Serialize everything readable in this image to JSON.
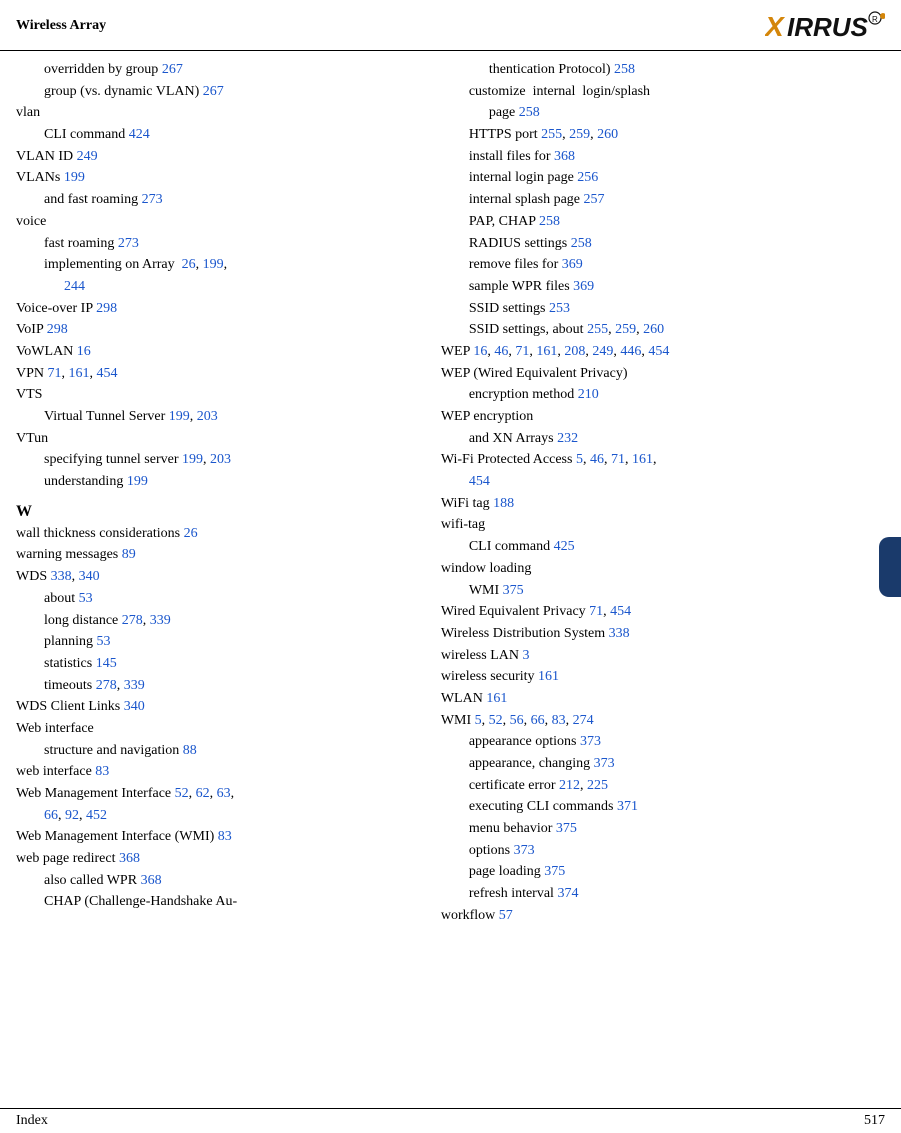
{
  "header": {
    "title": "Wireless Array",
    "logo": "XIRRUS"
  },
  "footer": {
    "left": "Index",
    "right": "517"
  },
  "left_column": [
    {
      "type": "sub-term",
      "text": "overridden by group ",
      "refs": [
        {
          "text": "267",
          "page": "267"
        }
      ]
    },
    {
      "type": "sub-term",
      "text": "group (vs. dynamic VLAN) ",
      "refs": [
        {
          "text": "267",
          "page": "267"
        }
      ]
    },
    {
      "type": "main-term",
      "text": "vlan"
    },
    {
      "type": "sub-term",
      "text": "CLI command ",
      "refs": [
        {
          "text": "424",
          "page": "424"
        }
      ]
    },
    {
      "type": "main-term",
      "text": "VLAN ID ",
      "refs": [
        {
          "text": "249",
          "page": "249"
        }
      ]
    },
    {
      "type": "main-term",
      "text": "VLANs ",
      "refs": [
        {
          "text": "199",
          "page": "199"
        }
      ]
    },
    {
      "type": "sub-term",
      "text": "and fast roaming ",
      "refs": [
        {
          "text": "273",
          "page": "273"
        }
      ]
    },
    {
      "type": "main-term",
      "text": "voice"
    },
    {
      "type": "sub-term",
      "text": "fast roaming ",
      "refs": [
        {
          "text": "273",
          "page": "273"
        }
      ]
    },
    {
      "type": "sub-term",
      "text": "implementing on Array ",
      "refs": [
        {
          "text": "26",
          "page": "26"
        },
        {
          "text": "199",
          "page": "199"
        },
        {
          "text": "244",
          "page": "244"
        }
      ]
    },
    {
      "type": "main-term",
      "text": "Voice-over IP ",
      "refs": [
        {
          "text": "298",
          "page": "298"
        }
      ]
    },
    {
      "type": "main-term",
      "text": "VoIP ",
      "refs": [
        {
          "text": "298",
          "page": "298"
        }
      ]
    },
    {
      "type": "main-term",
      "text": "VoWLAN ",
      "refs": [
        {
          "text": "16",
          "page": "16"
        }
      ]
    },
    {
      "type": "main-term",
      "text": "VPN ",
      "refs": [
        {
          "text": "71",
          "page": "71"
        },
        {
          "text": "161",
          "page": "161"
        },
        {
          "text": "454",
          "page": "454"
        }
      ]
    },
    {
      "type": "main-term",
      "text": "VTS"
    },
    {
      "type": "sub-term",
      "text": "Virtual Tunnel Server ",
      "refs": [
        {
          "text": "199",
          "page": "199"
        },
        {
          "text": "203",
          "page": "203"
        }
      ]
    },
    {
      "type": "main-term",
      "text": "VTun"
    },
    {
      "type": "sub-term",
      "text": "specifying tunnel server ",
      "refs": [
        {
          "text": "199",
          "page": "199"
        },
        {
          "text": "203",
          "page": "203"
        }
      ]
    },
    {
      "type": "sub-term",
      "text": "understanding ",
      "refs": [
        {
          "text": "199",
          "page": "199"
        }
      ]
    },
    {
      "type": "blank"
    },
    {
      "type": "section-letter",
      "text": "W"
    },
    {
      "type": "main-term",
      "text": "wall thickness considerations ",
      "refs": [
        {
          "text": "26",
          "page": "26"
        }
      ]
    },
    {
      "type": "main-term",
      "text": "warning messages ",
      "refs": [
        {
          "text": "89",
          "page": "89"
        }
      ]
    },
    {
      "type": "main-term",
      "text": "WDS ",
      "refs": [
        {
          "text": "338",
          "page": "338"
        },
        {
          "text": "340",
          "page": "340"
        }
      ]
    },
    {
      "type": "sub-term",
      "text": "about ",
      "refs": [
        {
          "text": "53",
          "page": "53"
        }
      ]
    },
    {
      "type": "sub-term",
      "text": "long distance ",
      "refs": [
        {
          "text": "278",
          "page": "278"
        },
        {
          "text": "339",
          "page": "339"
        }
      ]
    },
    {
      "type": "sub-term",
      "text": "planning ",
      "refs": [
        {
          "text": "53",
          "page": "53"
        }
      ]
    },
    {
      "type": "sub-term",
      "text": "statistics ",
      "refs": [
        {
          "text": "145",
          "page": "145"
        }
      ]
    },
    {
      "type": "sub-term",
      "text": "timeouts ",
      "refs": [
        {
          "text": "278",
          "page": "278"
        },
        {
          "text": "339",
          "page": "339"
        }
      ]
    },
    {
      "type": "main-term",
      "text": "WDS Client Links ",
      "refs": [
        {
          "text": "340",
          "page": "340"
        }
      ]
    },
    {
      "type": "main-term",
      "text": "Web interface"
    },
    {
      "type": "sub-term",
      "text": "structure and navigation ",
      "refs": [
        {
          "text": "88",
          "page": "88"
        }
      ]
    },
    {
      "type": "main-term",
      "text": "web interface ",
      "refs": [
        {
          "text": "83",
          "page": "83"
        }
      ]
    },
    {
      "type": "main-term",
      "text": "Web Management Interface ",
      "refs": [
        {
          "text": "52",
          "page": "52"
        },
        {
          "text": "62",
          "page": "62"
        },
        {
          "text": "63",
          "page": "63"
        },
        {
          "text": "66",
          "page": "66"
        },
        {
          "text": "92",
          "page": "92"
        },
        {
          "text": "452",
          "page": "452"
        }
      ]
    },
    {
      "type": "main-term",
      "text": "Web Management Interface (WMI) ",
      "refs": [
        {
          "text": "83",
          "page": "83"
        }
      ]
    },
    {
      "type": "main-term",
      "text": "web page redirect ",
      "refs": [
        {
          "text": "368",
          "page": "368"
        }
      ]
    },
    {
      "type": "sub-term",
      "text": "also called WPR ",
      "refs": [
        {
          "text": "368",
          "page": "368"
        }
      ]
    },
    {
      "type": "sub-term",
      "text": "CHAP (Challenge-Handshake Au-",
      "refs": []
    }
  ],
  "right_column": [
    {
      "type": "sub-sub-term",
      "text": "thentication Protocol) ",
      "refs": [
        {
          "text": "258",
          "page": "258"
        }
      ]
    },
    {
      "type": "sub-term",
      "text": "customize  internal  login/splash",
      "refs": []
    },
    {
      "type": "sub-sub-term",
      "text": "page ",
      "refs": [
        {
          "text": "258",
          "page": "258"
        }
      ]
    },
    {
      "type": "sub-term",
      "text": "HTTPS port ",
      "refs": [
        {
          "text": "255",
          "page": "255"
        },
        {
          "text": "259",
          "page": "259"
        },
        {
          "text": "260",
          "page": "260"
        }
      ]
    },
    {
      "type": "sub-term",
      "text": "install files for ",
      "refs": [
        {
          "text": "368",
          "page": "368"
        }
      ]
    },
    {
      "type": "sub-term",
      "text": "internal login page ",
      "refs": [
        {
          "text": "256",
          "page": "256"
        }
      ]
    },
    {
      "type": "sub-term",
      "text": "internal splash page ",
      "refs": [
        {
          "text": "257",
          "page": "257"
        }
      ]
    },
    {
      "type": "sub-term",
      "text": "PAP, CHAP ",
      "refs": [
        {
          "text": "258",
          "page": "258"
        }
      ]
    },
    {
      "type": "sub-term",
      "text": "RADIUS settings ",
      "refs": [
        {
          "text": "258",
          "page": "258"
        }
      ]
    },
    {
      "type": "sub-term",
      "text": "remove files for ",
      "refs": [
        {
          "text": "369",
          "page": "369"
        }
      ]
    },
    {
      "type": "sub-term",
      "text": "sample WPR files ",
      "refs": [
        {
          "text": "369",
          "page": "369"
        }
      ]
    },
    {
      "type": "sub-term",
      "text": "SSID settings ",
      "refs": [
        {
          "text": "253",
          "page": "253"
        }
      ]
    },
    {
      "type": "sub-term",
      "text": "SSID settings, about ",
      "refs": [
        {
          "text": "255",
          "page": "255"
        },
        {
          "text": "259",
          "page": "259"
        },
        {
          "text": "260",
          "page": "260"
        }
      ]
    },
    {
      "type": "main-term",
      "text": "WEP ",
      "refs": [
        {
          "text": "16",
          "page": "16"
        },
        {
          "text": "46",
          "page": "46"
        },
        {
          "text": "71",
          "page": "71"
        },
        {
          "text": "161",
          "page": "161"
        },
        {
          "text": "208",
          "page": "208"
        },
        {
          "text": "249",
          "page": "249"
        },
        {
          "text": "446",
          "page": "446"
        },
        {
          "text": "454",
          "page": "454"
        }
      ]
    },
    {
      "type": "main-term",
      "text": "WEP (Wired Equivalent Privacy)"
    },
    {
      "type": "sub-term",
      "text": "encryption method ",
      "refs": [
        {
          "text": "210",
          "page": "210"
        }
      ]
    },
    {
      "type": "main-term",
      "text": "WEP encryption"
    },
    {
      "type": "sub-term",
      "text": "and XN Arrays ",
      "refs": [
        {
          "text": "232",
          "page": "232"
        }
      ]
    },
    {
      "type": "main-term",
      "text": "Wi-Fi Protected Access ",
      "refs": [
        {
          "text": "5",
          "page": "5"
        },
        {
          "text": "46",
          "page": "46"
        },
        {
          "text": "71",
          "page": "71"
        },
        {
          "text": "161",
          "page": "161"
        },
        {
          "text": "454",
          "page": "454"
        }
      ]
    },
    {
      "type": "main-term",
      "text": "WiFi tag ",
      "refs": [
        {
          "text": "188",
          "page": "188"
        }
      ]
    },
    {
      "type": "main-term",
      "text": "wifi-tag"
    },
    {
      "type": "sub-term",
      "text": "CLI command ",
      "refs": [
        {
          "text": "425",
          "page": "425"
        }
      ]
    },
    {
      "type": "main-term",
      "text": "window loading"
    },
    {
      "type": "sub-term",
      "text": "WMI ",
      "refs": [
        {
          "text": "375",
          "page": "375"
        }
      ]
    },
    {
      "type": "main-term",
      "text": "Wired Equivalent Privacy ",
      "refs": [
        {
          "text": "71",
          "page": "71"
        },
        {
          "text": "454",
          "page": "454"
        }
      ]
    },
    {
      "type": "main-term",
      "text": "Wireless Distribution System ",
      "refs": [
        {
          "text": "338",
          "page": "338"
        }
      ]
    },
    {
      "type": "main-term",
      "text": "wireless LAN ",
      "refs": [
        {
          "text": "3",
          "page": "3"
        }
      ]
    },
    {
      "type": "main-term",
      "text": "wireless security ",
      "refs": [
        {
          "text": "161",
          "page": "161"
        }
      ]
    },
    {
      "type": "main-term",
      "text": "WLAN ",
      "refs": [
        {
          "text": "161",
          "page": "161"
        }
      ]
    },
    {
      "type": "main-term",
      "text": "WMI ",
      "refs": [
        {
          "text": "5",
          "page": "5"
        },
        {
          "text": "52",
          "page": "52"
        },
        {
          "text": "56",
          "page": "56"
        },
        {
          "text": "66",
          "page": "66"
        },
        {
          "text": "83",
          "page": "83"
        },
        {
          "text": "274",
          "page": "274"
        }
      ]
    },
    {
      "type": "sub-term",
      "text": "appearance options ",
      "refs": [
        {
          "text": "373",
          "page": "373"
        }
      ]
    },
    {
      "type": "sub-term",
      "text": "appearance, changing ",
      "refs": [
        {
          "text": "373",
          "page": "373"
        }
      ]
    },
    {
      "type": "sub-term",
      "text": "certificate error ",
      "refs": [
        {
          "text": "212",
          "page": "212"
        },
        {
          "text": "225",
          "page": "225"
        }
      ]
    },
    {
      "type": "sub-term",
      "text": "executing CLI commands ",
      "refs": [
        {
          "text": "371",
          "page": "371"
        }
      ]
    },
    {
      "type": "sub-term",
      "text": "menu behavior ",
      "refs": [
        {
          "text": "375",
          "page": "375"
        }
      ]
    },
    {
      "type": "sub-term",
      "text": "options ",
      "refs": [
        {
          "text": "373",
          "page": "373"
        }
      ]
    },
    {
      "type": "sub-term",
      "text": "page loading ",
      "refs": [
        {
          "text": "375",
          "page": "375"
        }
      ]
    },
    {
      "type": "sub-term",
      "text": "refresh interval ",
      "refs": [
        {
          "text": "374",
          "page": "374"
        }
      ]
    },
    {
      "type": "main-term",
      "text": "workflow ",
      "refs": [
        {
          "text": "57",
          "page": "57"
        }
      ]
    }
  ]
}
